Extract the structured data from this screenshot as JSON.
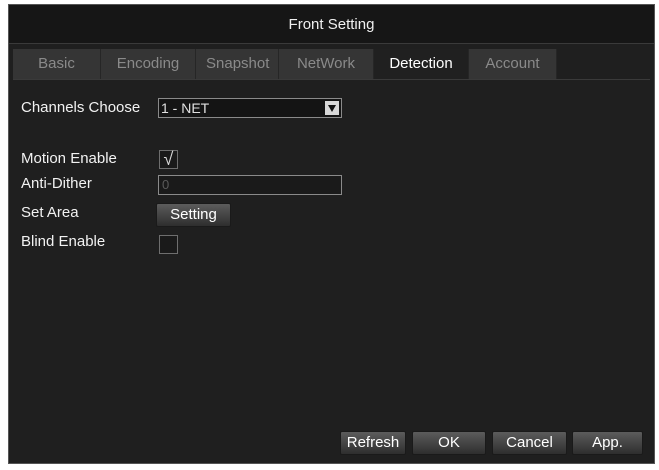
{
  "window": {
    "title": "Front Setting"
  },
  "tabs": [
    {
      "label": "Basic"
    },
    {
      "label": "Encoding"
    },
    {
      "label": "Snapshot"
    },
    {
      "label": "NetWork"
    },
    {
      "label": "Detection"
    },
    {
      "label": "Account"
    }
  ],
  "active_tab": "Detection",
  "form": {
    "channels_choose_label": "Channels Choose",
    "channels_choose_value": "1 - NET",
    "motion_enable_label": "Motion Enable",
    "motion_enable_checked": true,
    "anti_dither_label": "Anti-Dither",
    "anti_dither_value": "0",
    "set_area_label": "Set Area",
    "setting_button": "Setting",
    "blind_enable_label": "Blind Enable",
    "blind_enable_checked": false
  },
  "footer": {
    "refresh": "Refresh",
    "ok": "OK",
    "cancel": "Cancel",
    "apply": "App."
  },
  "icons": {
    "dropdown": "chevron-down-icon",
    "check": "check-icon"
  }
}
